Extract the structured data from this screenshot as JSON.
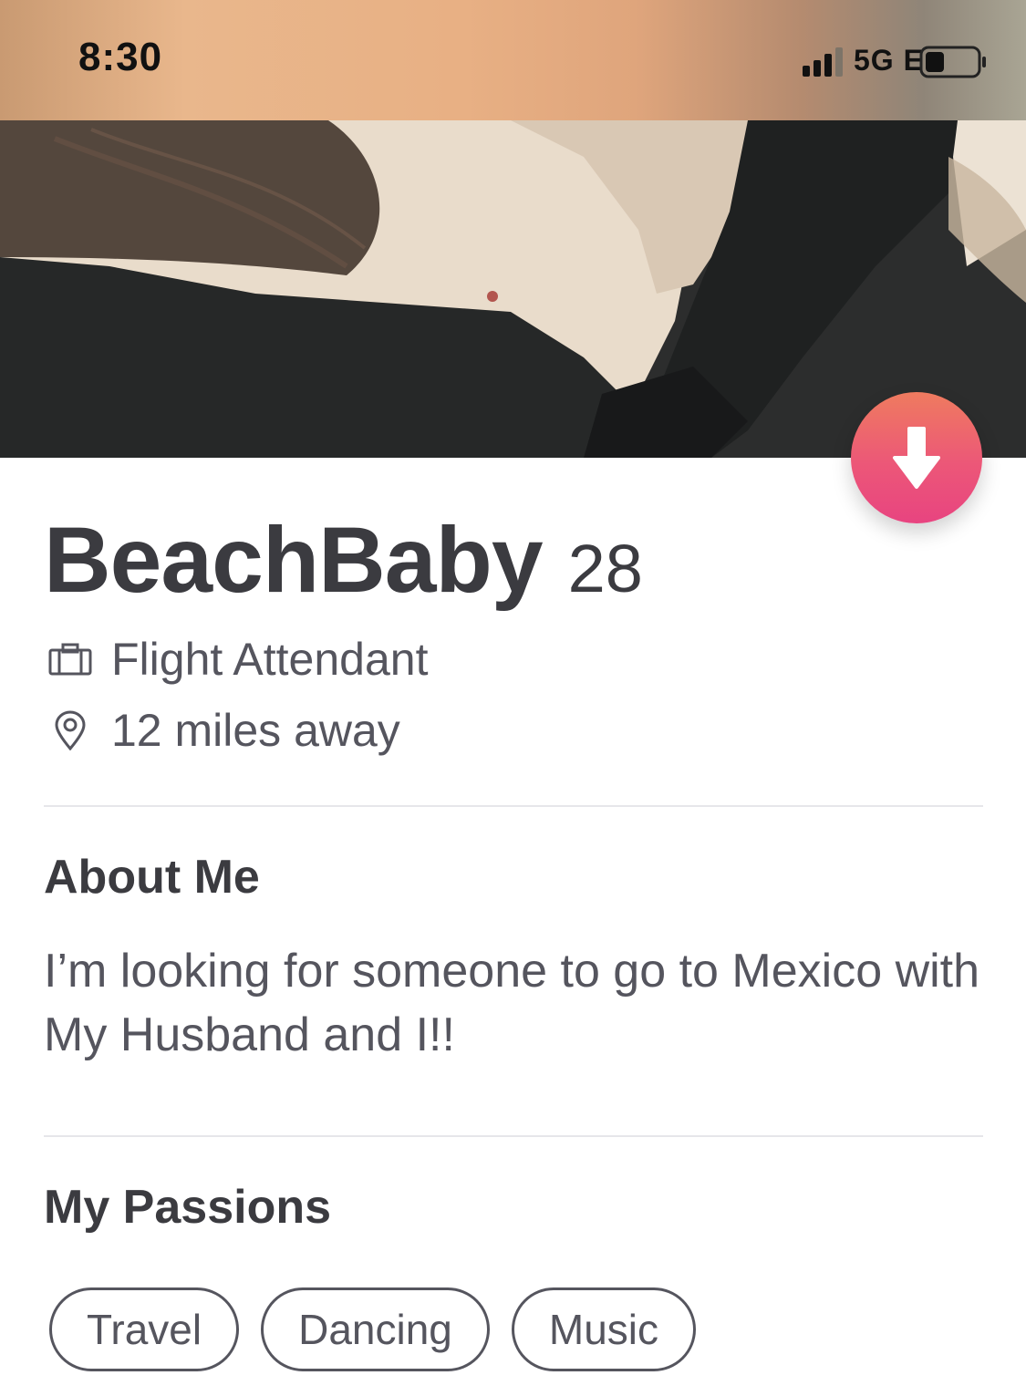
{
  "status_bar": {
    "time": "8:30",
    "network": "5G E",
    "icons": [
      "signal-icon",
      "battery-icon"
    ]
  },
  "photo": {
    "icon": "profile-photo"
  },
  "collapse_button": {
    "icon": "arrow-down-icon",
    "colors": [
      "#ef7b5f",
      "#e84480"
    ]
  },
  "profile": {
    "name": "BeachBaby",
    "age": "28",
    "job": {
      "icon": "briefcase-icon",
      "text": "Flight Attendant"
    },
    "distance": {
      "icon": "location-pin-icon",
      "text": "12 miles away"
    }
  },
  "about": {
    "heading": "About Me",
    "text": "I’m looking for someone to go to Mexico with My Husband and I!!"
  },
  "passions": {
    "heading": "My Passions",
    "items": [
      "Travel",
      "Dancing",
      "Music"
    ]
  }
}
